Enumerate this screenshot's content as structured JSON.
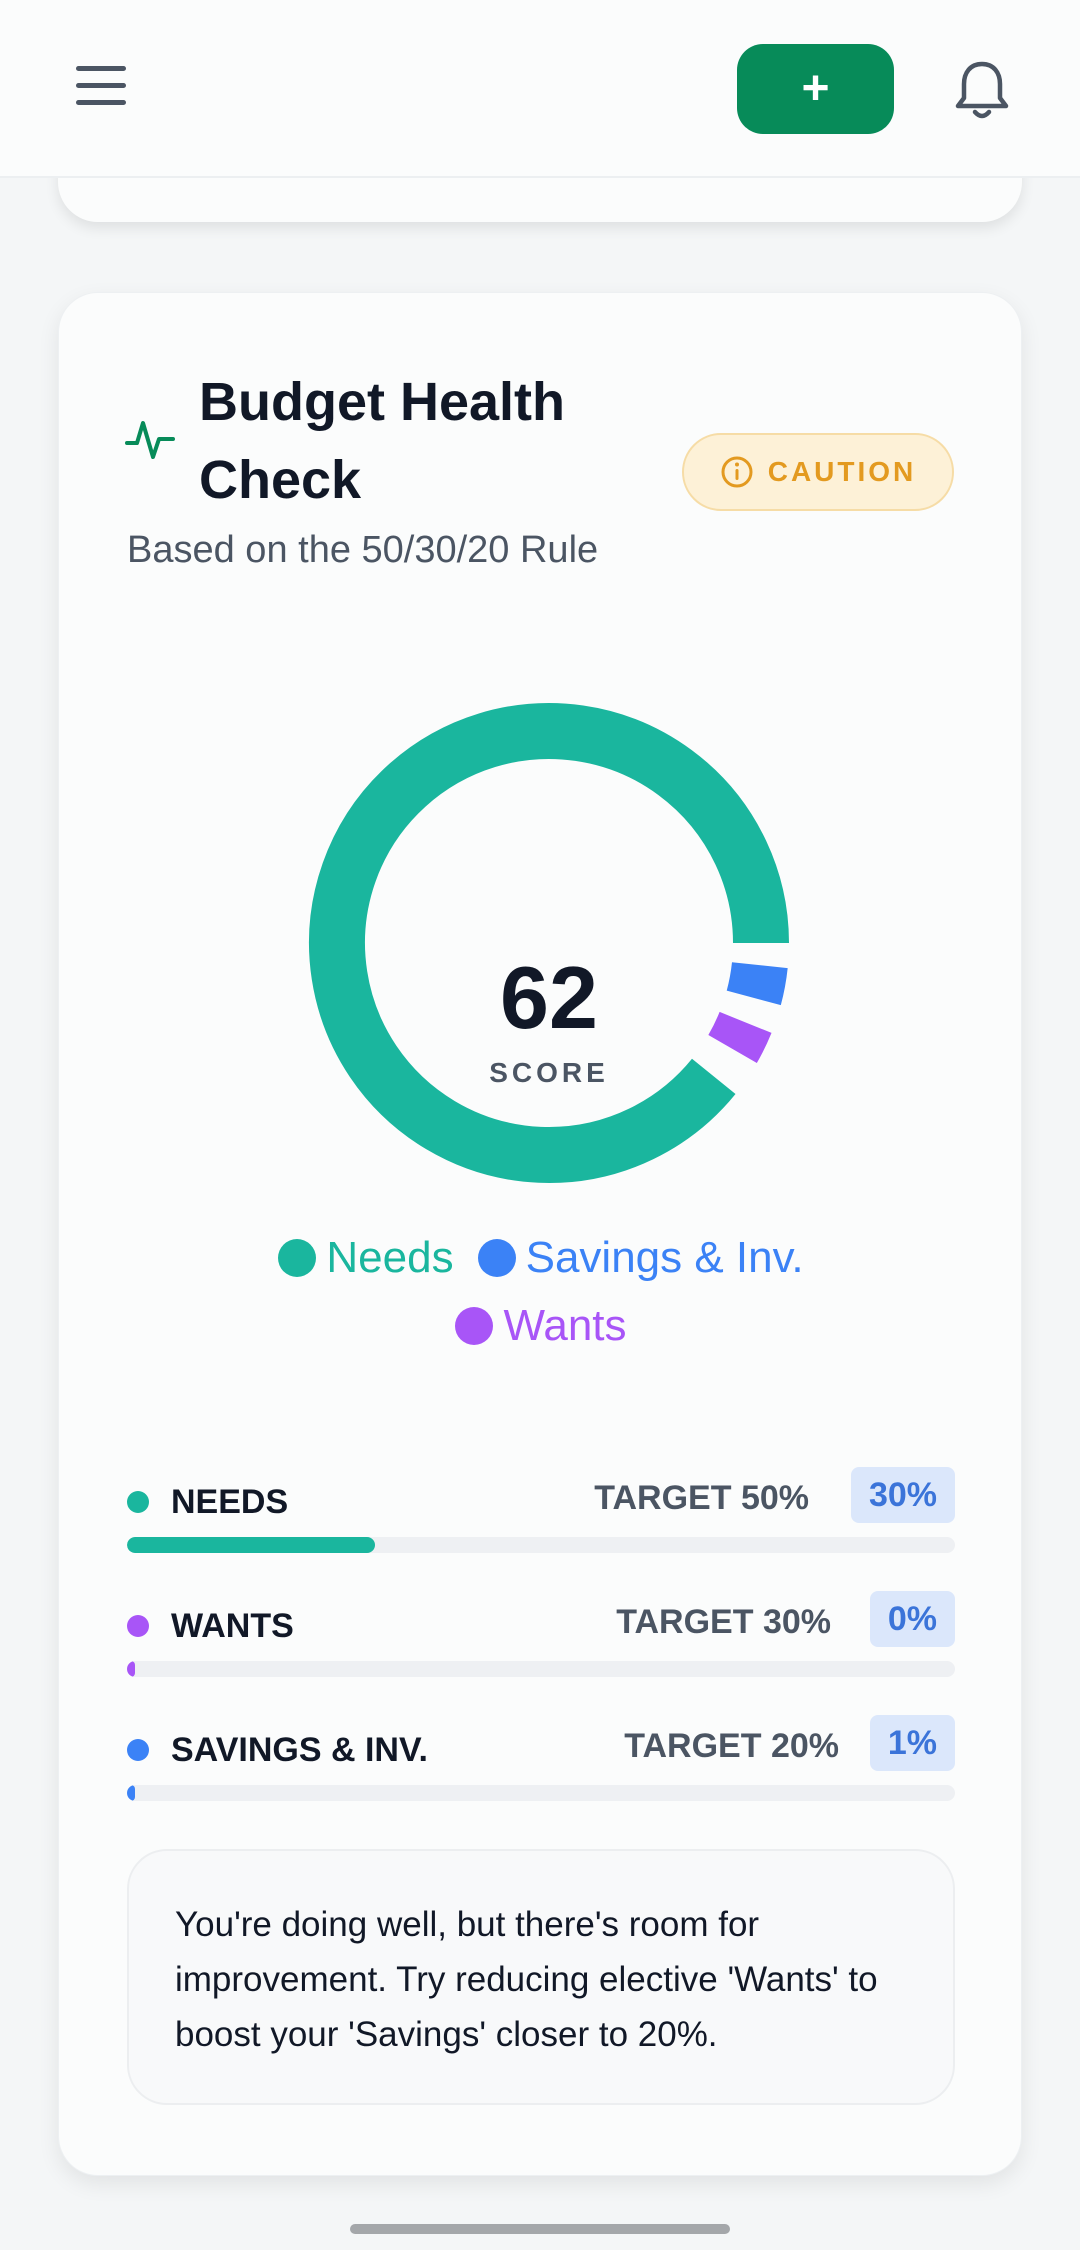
{
  "header": {
    "add_label": "+"
  },
  "card": {
    "title": "Budget Health Check",
    "status": "CAUTION",
    "subtitle": "Based on the 50/30/20 Rule"
  },
  "score": {
    "value": "62",
    "label": "SCORE"
  },
  "legend": {
    "needs": "Needs",
    "savings": "Savings & Inv.",
    "wants": "Wants"
  },
  "colors": {
    "needs": "#1ab69e",
    "wants": "#a855f7",
    "savings": "#3b82f6",
    "accent": "#078b59",
    "caution": "#e39a20"
  },
  "chart_data": {
    "type": "pie",
    "categories": [
      "Needs",
      "Savings & Inv.",
      "Wants"
    ],
    "values": [
      30,
      1,
      0
    ]
  },
  "rows": [
    {
      "name": "NEEDS",
      "target": "TARGET 50%",
      "value": "30%",
      "fill": 0.3,
      "color": "#1ab69e"
    },
    {
      "name": "WANTS",
      "target": "TARGET 30%",
      "value": "0%",
      "fill": 0.0,
      "color": "#a855f7"
    },
    {
      "name": "SAVINGS & INV.",
      "target": "TARGET 20%",
      "value": "1%",
      "fill": 0.01,
      "color": "#3b82f6"
    }
  ],
  "advice": "You're doing well, but there's room for improvement. Try reducing elective 'Wants' to boost your 'Savings' closer to 20%."
}
